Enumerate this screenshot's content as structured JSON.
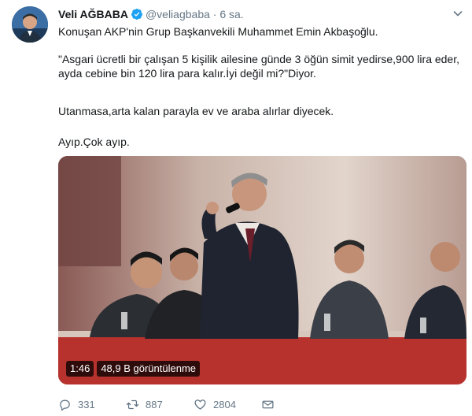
{
  "tweet": {
    "author_name": "Veli AĞBABA",
    "author_handle": "@veliagbaba",
    "separator": "·",
    "time": "6 sa.",
    "paragraphs": [
      "Konuşan AKP'nin Grup Başkanvekili Muhammet Emin Akbaşoğlu.",
      "\"Asgari ücretli bir çalışan 5 kişilik ailesine günde 3 öğün simit yedirse,900 lira eder,\nayda cebine bin 120 lira para kalır.İyi değil mi?\"Diyor.",
      "Utanmasa,arta kalan parayla ev ve araba alırlar diyecek.",
      "Ayıp.Çok ayıp."
    ],
    "video": {
      "duration": "1:46",
      "views": "48,9 B görüntülenme"
    },
    "actions": {
      "replies": "331",
      "retweets": "887",
      "likes": "2804"
    }
  },
  "icons": {
    "verified": "verified-badge-icon",
    "caret": "chevron-down-icon",
    "reply": "reply-icon",
    "retweet": "retweet-icon",
    "like": "heart-icon",
    "message": "envelope-icon"
  },
  "colors": {
    "text": "#14171a",
    "secondary": "#657786",
    "verified": "#1da1f2"
  }
}
